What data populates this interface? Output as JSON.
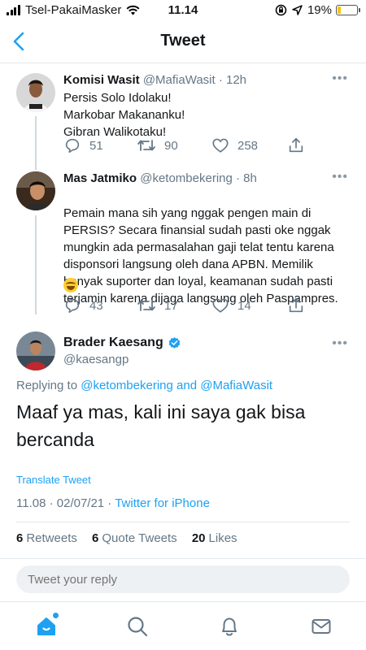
{
  "status_bar": {
    "carrier": "Tsel-PakaiMasker",
    "time": "11.14",
    "battery": "19%",
    "battery_level": 0.19
  },
  "header": {
    "title": "Tweet"
  },
  "tweets": [
    {
      "name": "Komisi Wasit",
      "meta": "@MafiaWasit · 12h",
      "text": "Persis Solo Idolaku!\nMarkobar Makananku!\nGibran Walikotaku!",
      "replies": "51",
      "retweets": "90",
      "likes": "258"
    },
    {
      "name": "Mas Jatmiko",
      "meta": "@ketombekering · 8h",
      "text": "Pemain mana sih yang nggak pengen main di PERSIS? Secara finansial sudah pasti oke nggak mungkin ada permasalahan gaji telat tentu karena disponsori langsung oleh dana APBN. Memilik banyak suporter dan loyal, keamanan sudah pasti terjamin karena dijaga langsung oleh Paspampres.",
      "emoji": "laughing-tears",
      "replies": "43",
      "retweets": "17",
      "likes": "14"
    }
  ],
  "main_tweet": {
    "name": "Brader Kaesang",
    "handle": "@kaesangp",
    "replying_prefix": "Replying to",
    "replying_to_1": "@ketombekering",
    "replying_and": "and",
    "replying_to_2": "@MafiaWasit",
    "text": "Maaf ya mas, kali ini saya gak bisa bercanda",
    "translate": "Translate Tweet",
    "timestamp": "11.08 · 02/07/21 · ",
    "source": "Twitter for iPhone",
    "retweets_count": "6",
    "retweets_label": "Retweets",
    "quotes_count": "6",
    "quotes_label": "Quote Tweets",
    "likes_count": "20",
    "likes_label": "Likes"
  },
  "reply": {
    "placeholder": "Tweet your reply"
  },
  "colors": {
    "accent": "#1da1f2",
    "muted": "#657786",
    "text": "#14171a",
    "divider": "#e1e8ed"
  },
  "icons": [
    "back-icon",
    "more-icon",
    "reply-icon",
    "retweet-icon",
    "like-icon",
    "share-icon",
    "verified-icon",
    "home-icon",
    "search-icon",
    "notifications-icon",
    "messages-icon"
  ]
}
